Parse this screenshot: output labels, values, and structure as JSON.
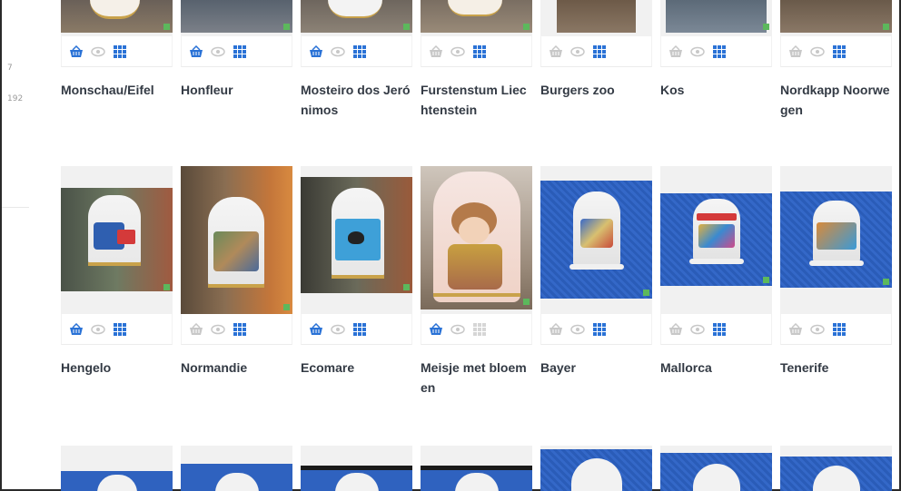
{
  "sidebar": {
    "numbers": [
      "7",
      "192"
    ]
  },
  "colors": {
    "accent_blue": "#2a72d6",
    "muted_gray": "#c8c8c8",
    "badge_green": "#5cb85c"
  },
  "rows": [
    {
      "cards": [
        {
          "title": "Monschau/Eifel",
          "basket_active": true,
          "grid_active": true
        },
        {
          "title": "Honfleur",
          "basket_active": true,
          "grid_active": true
        },
        {
          "title": "Mosteiro dos Jerónimos",
          "basket_active": true,
          "grid_active": true
        },
        {
          "title": "Furstenstum Liechtenstein",
          "basket_active": false,
          "grid_active": true
        },
        {
          "title": "Burgers zoo",
          "basket_active": false,
          "grid_active": true
        },
        {
          "title": "Kos",
          "basket_active": false,
          "grid_active": true
        },
        {
          "title": "Nordkapp Noorwegen",
          "basket_active": false,
          "grid_active": true
        }
      ]
    },
    {
      "cards": [
        {
          "title": "Hengelo",
          "basket_active": true,
          "grid_active": true
        },
        {
          "title": "Normandie",
          "basket_active": false,
          "grid_active": true
        },
        {
          "title": "Ecomare",
          "basket_active": true,
          "grid_active": true
        },
        {
          "title": "Meisje met bloemen",
          "basket_active": true,
          "grid_active": false
        },
        {
          "title": "Bayer",
          "basket_active": false,
          "grid_active": true
        },
        {
          "title": "Mallorca",
          "basket_active": false,
          "grid_active": true
        },
        {
          "title": "Tenerife",
          "basket_active": false,
          "grid_active": true
        }
      ]
    },
    {
      "cards": [
        {
          "title": ""
        },
        {
          "title": ""
        },
        {
          "title": ""
        },
        {
          "title": ""
        },
        {
          "title": ""
        },
        {
          "title": ""
        },
        {
          "title": ""
        }
      ]
    }
  ],
  "icons": {
    "basket": "basket-icon",
    "view": "eye-icon",
    "grid": "grid-icon"
  }
}
